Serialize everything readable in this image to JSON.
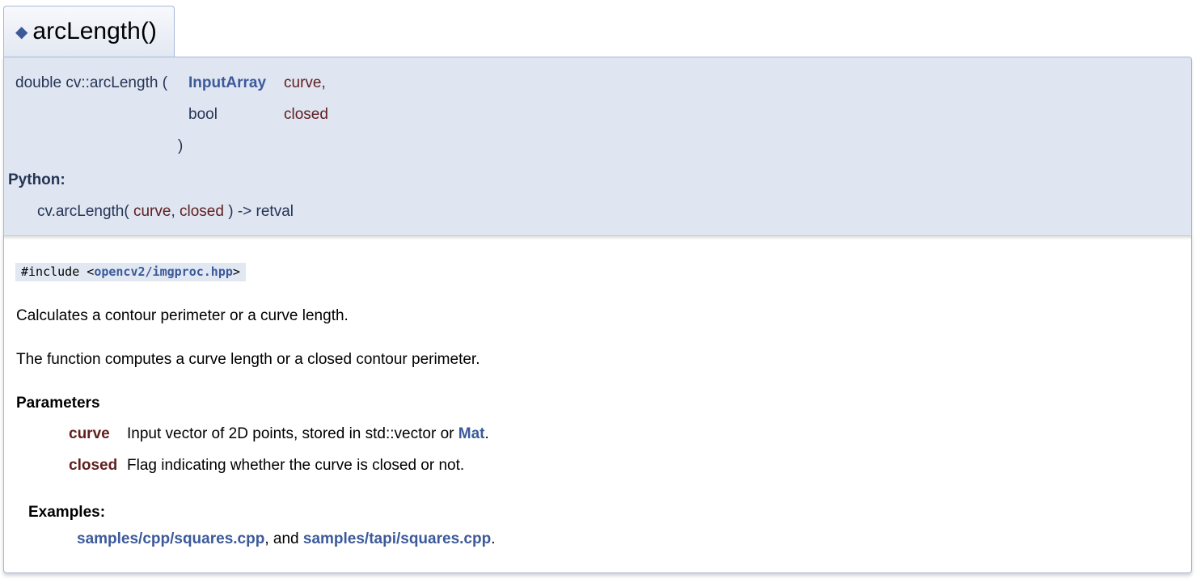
{
  "header": {
    "icon": "diamond-icon",
    "title": "arcLength()"
  },
  "prototype": {
    "return_type": "double",
    "function_name": "cv::arcLength",
    "open_paren": "(",
    "close_paren": ")",
    "params": [
      {
        "type": "InputArray",
        "name": "curve,"
      },
      {
        "type": "bool",
        "name": "closed"
      }
    ],
    "python_label": "Python:",
    "python_signature": {
      "prefix": "cv.arcLength(",
      "param1": "curve",
      "sep": ",",
      "param2": "closed",
      "suffix": ") -> retval"
    }
  },
  "doc": {
    "include_prefix": "#include <",
    "include_file": "opencv2/imgproc.hpp",
    "include_suffix": ">",
    "brief": "Calculates a contour perimeter or a curve length.",
    "detail": "The function computes a curve length or a closed contour perimeter.",
    "parameters_heading": "Parameters",
    "parameters": [
      {
        "name": "curve",
        "desc": "Input vector of 2D points, stored in std::vector or ",
        "link": "Mat",
        "tail": "."
      },
      {
        "name": "closed",
        "desc": "Flag indicating whether the curve is closed or not."
      }
    ],
    "examples_heading": "Examples:",
    "examples": {
      "link1": "samples/cpp/squares.cpp",
      "joiner": ", and ",
      "link2": "samples/tapi/squares.cpp",
      "tail": "."
    }
  },
  "colors": {
    "link": "#3c5a9a",
    "param_name": "#602020",
    "proto_bg": "#dfe5f1",
    "border": "#a8b8d9"
  }
}
